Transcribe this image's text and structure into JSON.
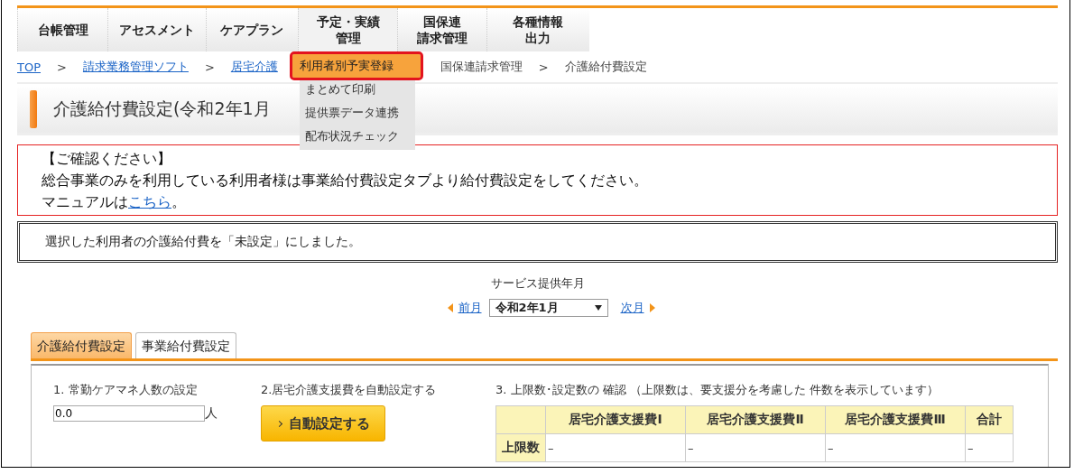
{
  "nav": {
    "items": [
      {
        "lines": [
          "台帳管理"
        ],
        "open": false
      },
      {
        "lines": [
          "アセスメント"
        ],
        "open": false
      },
      {
        "lines": [
          "ケアプラン"
        ],
        "open": false
      },
      {
        "lines": [
          "予定・実績",
          "管理"
        ],
        "open": true
      },
      {
        "lines": [
          "国保連",
          "請求管理"
        ],
        "open": false
      },
      {
        "lines": [
          "各種情報",
          "出力"
        ],
        "open": false
      }
    ]
  },
  "menu": {
    "items": [
      {
        "label": "利用者別予実登録",
        "selected": true
      },
      {
        "label": "まとめて印刷",
        "selected": false
      },
      {
        "label": "提供票データ連携",
        "selected": false
      },
      {
        "label": "配布状況チェック",
        "selected": false
      }
    ]
  },
  "breadcrumb": [
    {
      "label": "TOP",
      "link": true
    },
    {
      "label": ">",
      "link": false
    },
    {
      "label": "請求業務管理ソフト",
      "link": true
    },
    {
      "label": ">",
      "link": false
    },
    {
      "label": "居宅介護",
      "link": true
    },
    {
      "label": "国保連請求管理",
      "link": false
    },
    {
      "label": ">",
      "link": false
    },
    {
      "label": "介護給付費設定",
      "link": false
    }
  ],
  "page_title": "介護給付費設定(令和2年1月",
  "notice": {
    "heading": "【ご確認ください】",
    "body": "総合事業のみを利用している利用者様は事業給付費設定タブより給付費設定をしてください。",
    "manual_prefix": "マニュアルは",
    "manual_link": "こちら",
    "manual_suffix": "。"
  },
  "message": "選択した利用者の介護給付費を「未設定」にしました。",
  "month": {
    "label": "サービス提供年月",
    "prev": "前月",
    "value": "令和2年1月",
    "next": "次月"
  },
  "tabs": [
    {
      "label": "介護給付費設定",
      "selected": true
    },
    {
      "label": "事業給付費設定",
      "selected": false
    }
  ],
  "section1": {
    "label": "1. 常勤ケアマネ人数の設定",
    "value": "0.0",
    "unit": "人"
  },
  "section2": {
    "label": "2.居宅介護支援費を自動設定する",
    "button": "自動設定する"
  },
  "section3": {
    "label": "3. 上限数･設定数の 確認 （上限数は、要支援分を考慮した 件数を表示しています）",
    "table": {
      "columns": [
        "居宅介護支援費Ⅰ",
        "居宅介護支援費Ⅱ",
        "居宅介護支援費Ⅲ",
        "合計"
      ],
      "rows": [
        {
          "header": "上限数",
          "cells": [
            "–",
            "–",
            "–",
            "–"
          ]
        }
      ]
    }
  }
}
